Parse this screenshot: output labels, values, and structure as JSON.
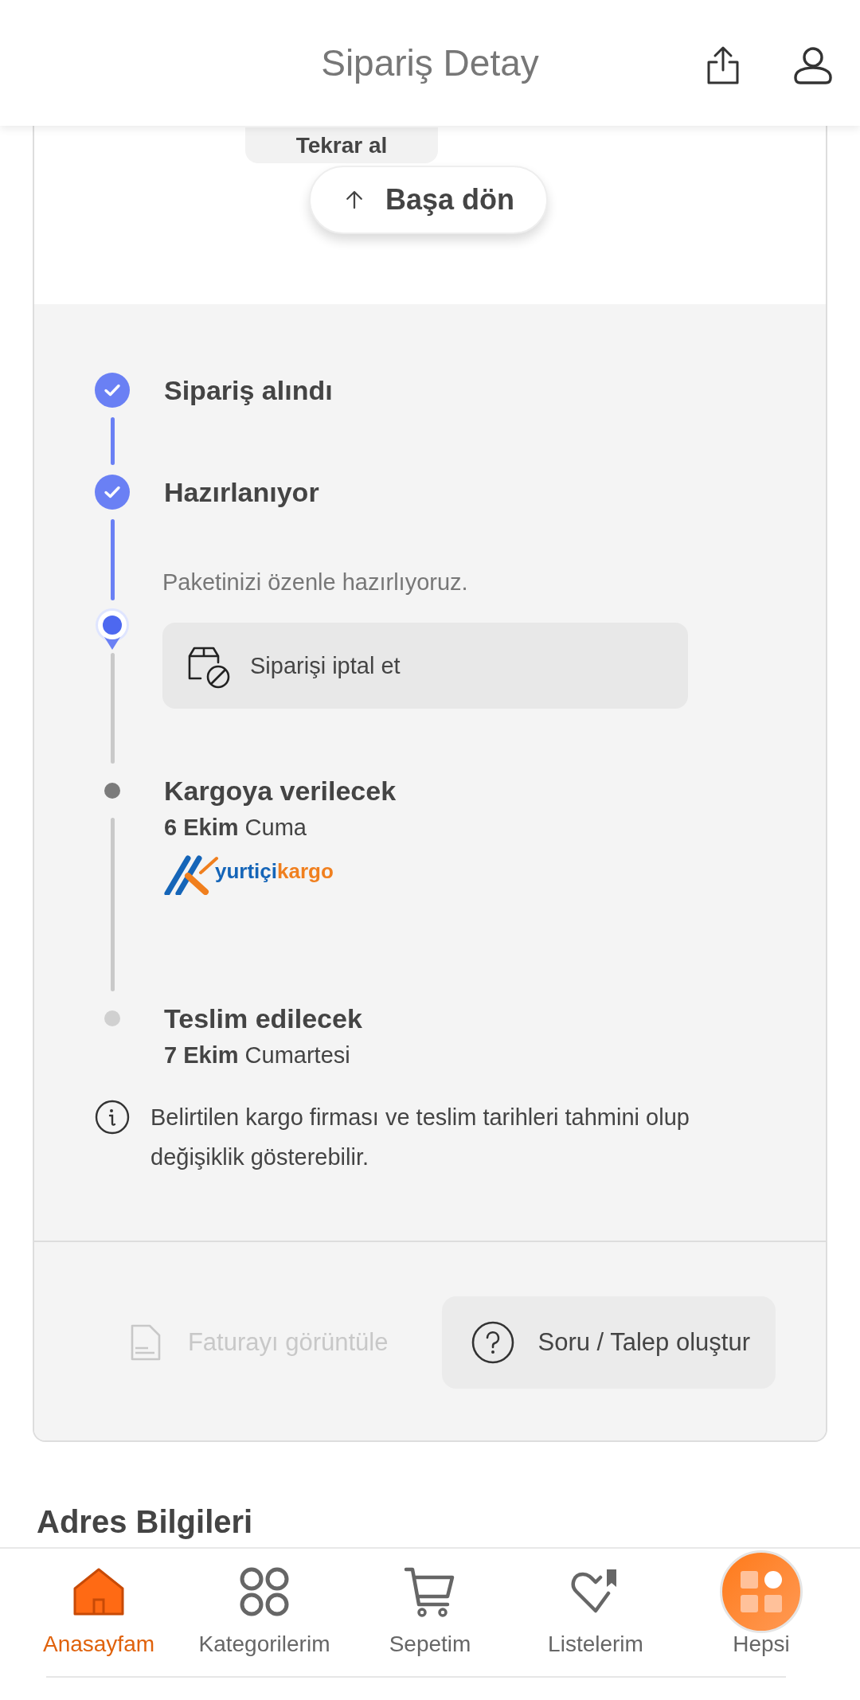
{
  "header": {
    "title": "Sipariş Detay"
  },
  "actions": {
    "reorder": "Tekrar al",
    "back_to_top": "Başa dön"
  },
  "timeline": [
    {
      "kind": "done",
      "title": "Sipariş alındı"
    },
    {
      "kind": "done",
      "title": "Hazırlanıyor",
      "note": "Paketinizi özenle hazırlıyoruz."
    },
    {
      "kind": "current",
      "action": "Siparişi iptal et"
    },
    {
      "kind": "next",
      "title": "Kargoya verilecek",
      "date": "**6 Ekim** Cuma",
      "carrier": {
        "name": "yurtiçi",
        "suffix": "kargo"
      }
    },
    {
      "kind": "later",
      "title": "Teslim edilecek",
      "date": "**7 Ekim** Cumartesi"
    }
  ],
  "info": "Belirtilen kargo firması ve teslim tarihleri tahmini olup değişiklik gösterebilir.",
  "buttons": [
    {
      "label": "Faturayı görüntüle",
      "disabled": true
    },
    {
      "label": "Soru / Talep oluştur",
      "disabled": false
    }
  ],
  "section_heading": "Adres Bilgileri",
  "nav": [
    {
      "label": "Anasayfam",
      "selected": true
    },
    {
      "label": "Kategorilerim",
      "selected": false
    },
    {
      "label": "Sepetim",
      "selected": false
    },
    {
      "label": "Listelerim",
      "selected": false
    },
    {
      "label": "Hepsi",
      "selected": false
    }
  ]
}
